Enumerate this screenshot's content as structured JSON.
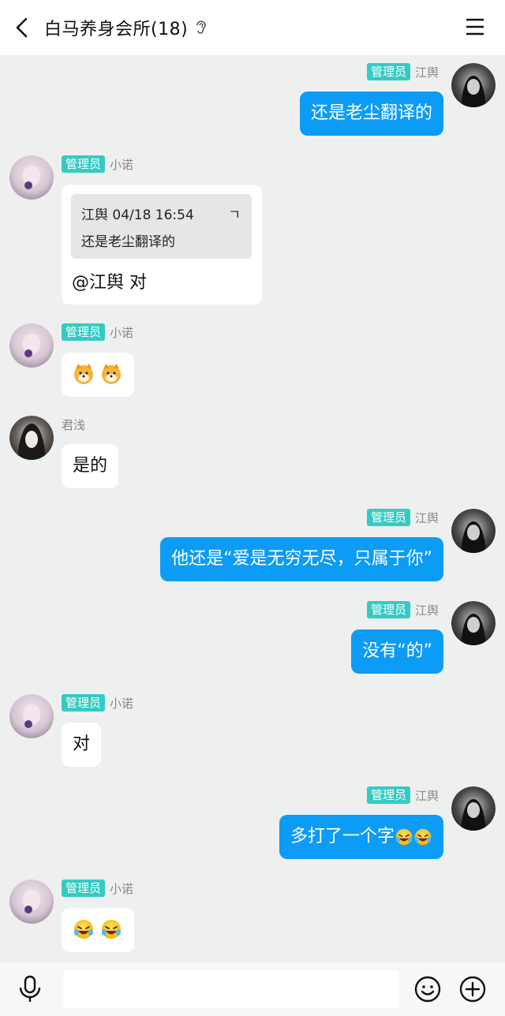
{
  "header": {
    "title": "白马养身会所(18)",
    "back_icon": "chevron-left-icon",
    "ear_icon": "ear-icon",
    "menu_icon": "hamburger-menu-icon"
  },
  "colors": {
    "badge": "#35cbc3",
    "outgoing_bubble": "#0c9cf6",
    "background": "#edf0ee"
  },
  "messages": [
    {
      "sender": "江舆",
      "badge": "管理员",
      "direction": "out",
      "text": "还是老尘翻译的"
    },
    {
      "sender": "小诺",
      "badge": "管理员",
      "direction": "in",
      "quote": {
        "header": "江舆 04/18 16:54",
        "close": "ㄱ",
        "text": "还是老尘翻译的"
      },
      "text": "@江舆 对"
    },
    {
      "sender": "小诺",
      "badge": "管理员",
      "direction": "in",
      "emojis": [
        "doge-emoji",
        "doge-emoji"
      ]
    },
    {
      "sender": "君浅",
      "direction": "in",
      "text": "是的"
    },
    {
      "sender": "江舆",
      "badge": "管理员",
      "direction": "out",
      "text": "他还是“爱是无穷无尽，只属于你”"
    },
    {
      "sender": "江舆",
      "badge": "管理员",
      "direction": "out",
      "text": "没有“的”"
    },
    {
      "sender": "小诺",
      "badge": "管理员",
      "direction": "in",
      "text": "对"
    },
    {
      "sender": "江舆",
      "badge": "管理员",
      "direction": "out",
      "text": "多打了一个字",
      "emojis": [
        "laugh-tears-emoji",
        "laugh-tears-emoji"
      ]
    },
    {
      "sender": "小诺",
      "badge": "管理员",
      "direction": "in",
      "emojis": [
        "laugh-tears-emoji",
        "laugh-tears-emoji"
      ]
    }
  ],
  "input": {
    "placeholder": ""
  },
  "toolbar_icons": [
    "microphone-icon",
    "smiley-icon",
    "plus-circle-icon"
  ]
}
